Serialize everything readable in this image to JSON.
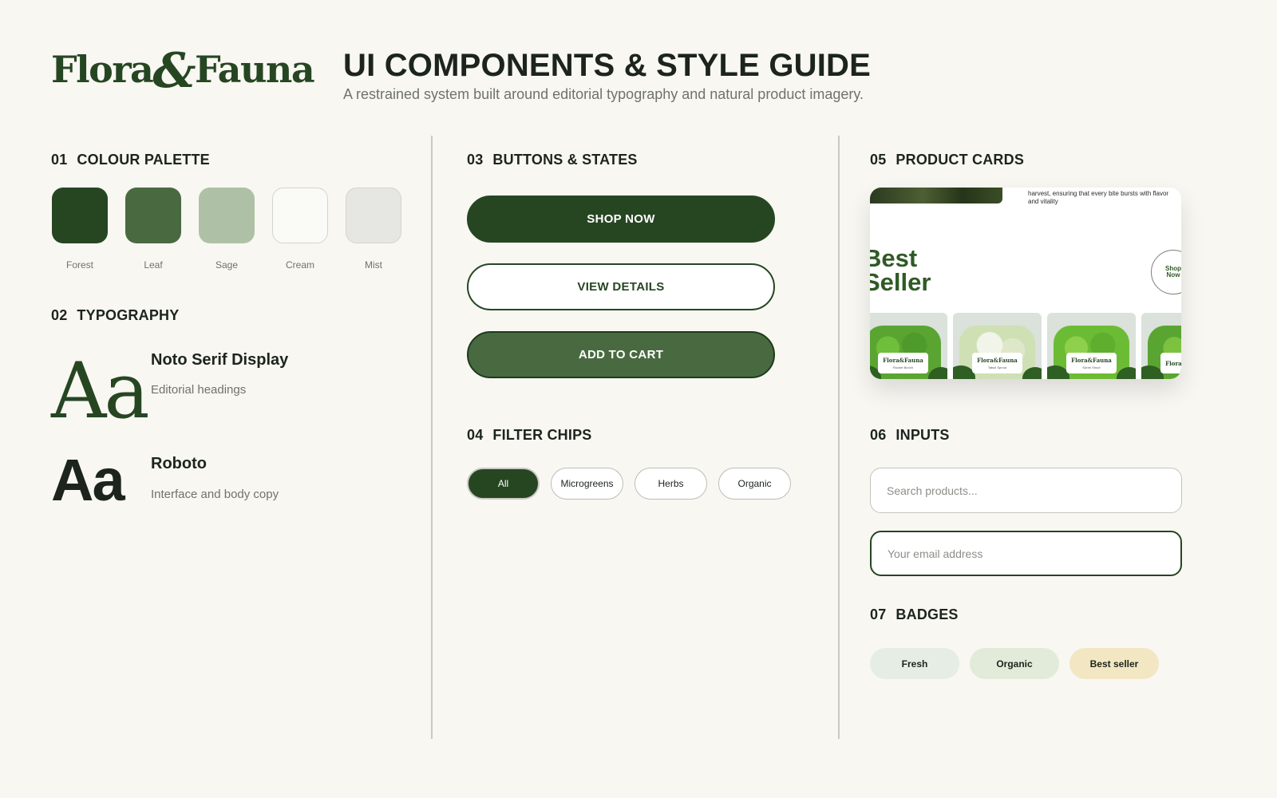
{
  "header": {
    "brand_left": "Flora",
    "brand_amp": "&",
    "brand_right": "Fauna",
    "title": "UI COMPONENTS & STYLE GUIDE",
    "subtitle": "A restrained system built around editorial typography and natural product imagery."
  },
  "sections": {
    "palette": {
      "num": "01",
      "title": "COLOUR PALETTE"
    },
    "typography": {
      "num": "02",
      "title": "TYPOGRAPHY"
    },
    "buttons": {
      "num": "03",
      "title": "BUTTONS & STATES"
    },
    "chips": {
      "num": "04",
      "title": "FILTER CHIPS"
    },
    "product_cards": {
      "num": "05",
      "title": "PRODUCT CARDS"
    },
    "inputs": {
      "num": "06",
      "title": "INPUTS"
    },
    "badges": {
      "num": "07",
      "title": "BADGES"
    }
  },
  "palette": [
    {
      "name": "Forest",
      "color": "#264622"
    },
    {
      "name": "Leaf",
      "color": "#496a40"
    },
    {
      "name": "Sage",
      "color": "#aec1a6"
    },
    {
      "name": "Cream",
      "color": "#fafaf7"
    },
    {
      "name": "Mist",
      "color": "#e6e7e3"
    }
  ],
  "typography": {
    "serif": {
      "sample": "Aa",
      "name": "Noto Serif Display",
      "description": "Editorial headings"
    },
    "sans": {
      "sample": "Aa",
      "name": "Roboto",
      "description": "Interface and body copy"
    }
  },
  "buttons": {
    "primary": "SHOP NOW",
    "secondary": "VIEW DETAILS",
    "cart": "ADD TO CART"
  },
  "chips": [
    "All",
    "Microgreens",
    "Herbs",
    "Organic"
  ],
  "product_card": {
    "caption": "harvest, ensuring that every bite bursts with flavor and vitality",
    "heading_line1": "Best",
    "heading_line2": "Seller",
    "shop_line1": "Shop",
    "shop_line2": "Now",
    "tiles": [
      {
        "brand": "Flora&Fauna",
        "product": "Rocket Bunch"
      },
      {
        "brand": "Flora&Fauna",
        "product": "Tatsoi Sprout"
      },
      {
        "brand": "Flora&Fauna",
        "product": "Sorrel Shoot"
      },
      {
        "brand": "Flora&Fauna",
        "product": ""
      }
    ]
  },
  "inputs": {
    "search_placeholder": "Search products...",
    "email_placeholder": "Your email address"
  },
  "badges": [
    {
      "label": "Fresh",
      "color": "#e6ede4"
    },
    {
      "label": "Organic",
      "color": "#e2ebd9"
    },
    {
      "label": "Best seller",
      "color": "#f2e7c2"
    }
  ],
  "colors": {
    "background": "#f8f7f2",
    "forest": "#264622",
    "text": "#1c241d",
    "muted": "#6f736c"
  }
}
